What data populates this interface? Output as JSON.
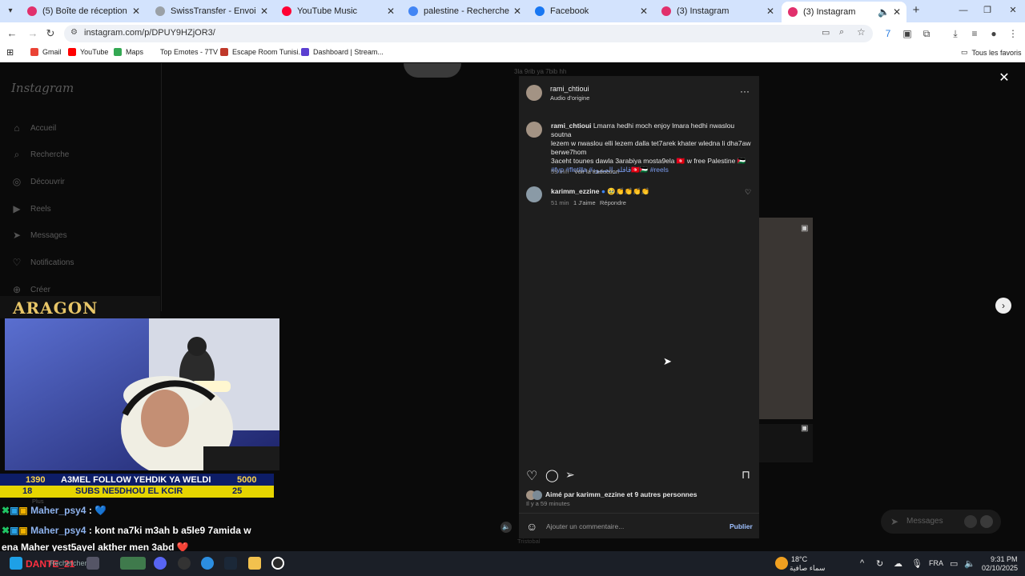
{
  "browser": {
    "tabs": [
      {
        "title": "(5) Boîte de réception • Direct",
        "color": "#e1306c"
      },
      {
        "title": "SwissTransfer - Envoi sécurisé e",
        "color": "#9aa0a6"
      },
      {
        "title": "YouTube Music",
        "color": "#ff0033"
      },
      {
        "title": "palestine - Recherche Google",
        "color": "#4285f4"
      },
      {
        "title": "Facebook",
        "color": "#1877f2"
      },
      {
        "title": "(3) Instagram",
        "color": "#e1306c"
      },
      {
        "title": "(3) Instagram",
        "color": "#e1306c"
      }
    ],
    "url": "instagram.com/p/DPUY9HZjOR3/",
    "bookmarks": [
      "Gmail",
      "YouTube",
      "Maps",
      "Top Emotes - 7TV",
      "Escape Room Tunisi...",
      "Dashboard | Stream..."
    ],
    "all_bookmarks": "Tous les favoris"
  },
  "instagram": {
    "logo": "Instagram",
    "nav": [
      "Accueil",
      "Recherche",
      "Découvrir",
      "Reels",
      "Messages",
      "Notifications",
      "Créer"
    ],
    "behind_text": "3la 9rib ya 7bib hh",
    "post": {
      "author": "rami_chtioui",
      "audio": "Audio d'origine",
      "caption_user": "rami_chtioui",
      "caption_line1": "Lmarra hedhi moch enjoy lmara hedhi nwaslou soutna",
      "caption_line2": "lezem w nwaslou elli lezem dalla tet7arek khater wledna li dha7aw",
      "caption_line3": "berwe7hom",
      "caption_line4": "3aceht tounes dawla 3arabiya mosta9ela 🇹🇳 w free Palestine 🇵🇸",
      "hashtags": "#fyp #flotilla #قافلة_الصمود🇹🇳🇵🇸 #reels",
      "caption_time": "59 min",
      "translate": "Voir la traduction",
      "comment_user": "karimm_ezzine",
      "comment_text": "🥹👏👏👏👏",
      "comment_time": "51 min",
      "comment_likes": "1 J'aime",
      "comment_reply": "Répondre",
      "liked_by": "Aimé par karimm_ezzine et 9 autres personnes",
      "posted": "Il y a 59 minutes",
      "add_comment": "Ajouter un commentaire...",
      "publish": "Publier"
    },
    "messages_pill": "Messages",
    "below_text": "Tristobal"
  },
  "stream": {
    "brand": "ARAGON",
    "banner_left_num": "1390",
    "banner_text": "A3MEL FOLLOW YEHDIK YA WELDI",
    "banner_right_num": "5000",
    "banner2_left_num": "18",
    "banner2_text": "SUBS NE5DHOU EL KCIR",
    "banner2_right_num": "25",
    "more": "Plus",
    "chat": [
      {
        "user": "Maher_psy4",
        "text": ": 💙"
      },
      {
        "user": "Maher_psy4",
        "text": ": kont na7ki m3ah b a5le9 7amida w"
      },
      {
        "user": "",
        "text": "ena Maher yest5ayel akther men 3abd ❤️"
      }
    ],
    "tag": "DANTE_21"
  },
  "taskbar": {
    "search": "Rechercher",
    "weather_temp": "18°C",
    "weather_desc": "سماء صافية",
    "lang": "FRA",
    "time": "9:31 PM",
    "date": "02/10/2025"
  }
}
